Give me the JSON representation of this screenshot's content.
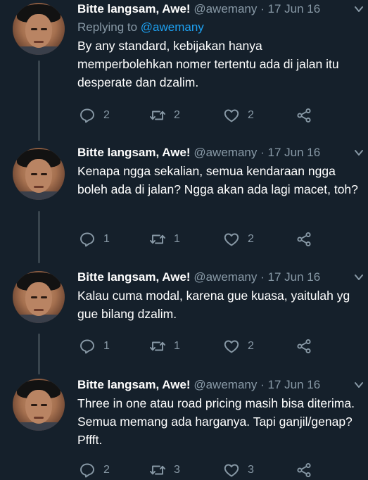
{
  "colors": {
    "background": "#15202b",
    "text": "#ffffff",
    "secondary": "#8899a6",
    "link": "#1da1f2",
    "thread_line": "#38444d"
  },
  "tweets": [
    {
      "name": "Bitte langsam, Awe!",
      "handle": "@awemany",
      "separator": "·",
      "date": "17 Jun 16",
      "reply_prefix": "Replying to",
      "reply_mention": "@awemany",
      "text": "By any standard, kebijakan hanya memperbolehkan nomer tertentu ada di jalan itu desperate dan dzalim.",
      "replies": "2",
      "retweets": "2",
      "likes": "2"
    },
    {
      "name": "Bitte langsam, Awe!",
      "handle": "@awemany",
      "separator": "·",
      "date": "17 Jun 16",
      "text": "Kenapa ngga sekalian, semua kendaraan ngga boleh ada di jalan? Ngga akan ada lagi macet, toh?",
      "replies": "1",
      "retweets": "1",
      "likes": "2"
    },
    {
      "name": "Bitte langsam, Awe!",
      "handle": "@awemany",
      "separator": "·",
      "date": "17 Jun 16",
      "text": "Kalau cuma modal, karena gue kuasa, yaitulah yg gue bilang dzalim.",
      "replies": "1",
      "retweets": "1",
      "likes": "2"
    },
    {
      "name": "Bitte langsam, Awe!",
      "handle": "@awemany",
      "separator": "·",
      "date": "17 Jun 16",
      "text": "Three in one atau road pricing masih bisa diterima. Semua memang ada harganya. Tapi ganjil/genap? Pffft.",
      "replies": "2",
      "retweets": "3",
      "likes": "3"
    }
  ]
}
